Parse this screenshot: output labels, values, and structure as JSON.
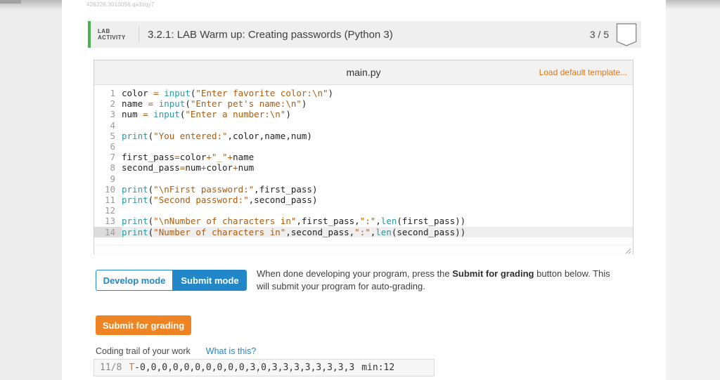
{
  "page": {
    "doc_id": "426226.3010056.qx3zqy7"
  },
  "colors": {
    "blue": "#2187c9",
    "orange": "#ee8424",
    "orange_link": "#e87511",
    "green": "#4caf50",
    "syn_plain": "#222222",
    "syn_builtin": "#2b9aa0",
    "syn_string": "#ad5b0e",
    "syn_op": "#a9590c"
  },
  "header": {
    "kicker_line1": "LAB",
    "kicker_line2": "ACTIVITY",
    "title": "3.2.1: LAB Warm up: Creating passwords (Python 3)",
    "score": "3 / 5"
  },
  "editor": {
    "filename": "main.py",
    "load_template_label": "Load default template...",
    "lines": [
      {
        "no": "1",
        "hl": false,
        "tokens": [
          [
            "p",
            "color "
          ],
          [
            "o",
            "="
          ],
          [
            "p",
            " "
          ],
          [
            "b",
            "input"
          ],
          [
            "p",
            "("
          ],
          [
            "s",
            "\"Enter favorite color:\\n\""
          ],
          [
            "p",
            ")"
          ]
        ]
      },
      {
        "no": "2",
        "hl": false,
        "tokens": [
          [
            "p",
            "name "
          ],
          [
            "o",
            "="
          ],
          [
            "p",
            " "
          ],
          [
            "b",
            "input"
          ],
          [
            "p",
            "("
          ],
          [
            "s",
            "\"Enter pet's name:\\n\""
          ],
          [
            "p",
            ")"
          ]
        ]
      },
      {
        "no": "3",
        "hl": false,
        "tokens": [
          [
            "p",
            "num "
          ],
          [
            "o",
            "="
          ],
          [
            "p",
            " "
          ],
          [
            "b",
            "input"
          ],
          [
            "p",
            "("
          ],
          [
            "s",
            "\"Enter a number:\\n\""
          ],
          [
            "p",
            ")"
          ]
        ]
      },
      {
        "no": "4",
        "hl": false,
        "tokens": []
      },
      {
        "no": "5",
        "hl": false,
        "tokens": [
          [
            "b",
            "print"
          ],
          [
            "p",
            "("
          ],
          [
            "s",
            "\"You entered:\""
          ],
          [
            "p",
            ",color,name,num)"
          ]
        ]
      },
      {
        "no": "6",
        "hl": false,
        "tokens": []
      },
      {
        "no": "7",
        "hl": false,
        "tokens": [
          [
            "p",
            "first_pass"
          ],
          [
            "o",
            "="
          ],
          [
            "p",
            "color"
          ],
          [
            "o",
            "+"
          ],
          [
            "s",
            "\"_\""
          ],
          [
            "o",
            "+"
          ],
          [
            "p",
            "name"
          ]
        ]
      },
      {
        "no": "8",
        "hl": false,
        "tokens": [
          [
            "p",
            "second_pass"
          ],
          [
            "o",
            "="
          ],
          [
            "p",
            "num"
          ],
          [
            "o",
            "+"
          ],
          [
            "p",
            "color"
          ],
          [
            "o",
            "+"
          ],
          [
            "p",
            "num"
          ]
        ]
      },
      {
        "no": "9",
        "hl": false,
        "tokens": []
      },
      {
        "no": "10",
        "hl": false,
        "tokens": [
          [
            "b",
            "print"
          ],
          [
            "p",
            "("
          ],
          [
            "s",
            "\"\\nFirst password:\""
          ],
          [
            "p",
            ",first_pass)"
          ]
        ]
      },
      {
        "no": "11",
        "hl": false,
        "tokens": [
          [
            "b",
            "print"
          ],
          [
            "p",
            "("
          ],
          [
            "s",
            "\"Second password:\""
          ],
          [
            "p",
            ",second_pass)"
          ]
        ]
      },
      {
        "no": "12",
        "hl": false,
        "tokens": []
      },
      {
        "no": "13",
        "hl": false,
        "tokens": [
          [
            "b",
            "print"
          ],
          [
            "p",
            "("
          ],
          [
            "s",
            "\"\\nNumber of characters in\""
          ],
          [
            "p",
            ",first_pass,"
          ],
          [
            "s",
            "\":\""
          ],
          [
            "p",
            ","
          ],
          [
            "b",
            "len"
          ],
          [
            "p",
            "(first_pass))"
          ]
        ]
      },
      {
        "no": "14",
        "hl": true,
        "tokens": [
          [
            "b",
            "print"
          ],
          [
            "p",
            "("
          ],
          [
            "s",
            "\"Number of characters in\""
          ],
          [
            "p",
            ",second_pass,"
          ],
          [
            "s",
            "\":\""
          ],
          [
            "p",
            ","
          ],
          [
            "b",
            "len"
          ],
          [
            "p",
            "(second_pass))"
          ]
        ]
      }
    ]
  },
  "modes": {
    "develop_label": "Develop mode",
    "submit_label": "Submit mode"
  },
  "instructions": {
    "before_bold": "When done developing your program, press the ",
    "bold": "Submit for grading",
    "after_bold": " button below. This will submit your program for auto-grading."
  },
  "submit": {
    "label": "Submit for grading"
  },
  "coding_trail": {
    "label": "Coding trail of your work",
    "help_link": "What is this?",
    "ratio": "11/8",
    "t_prefix": "T",
    "values": "-0,0,0,0,0,0,0,0,0,0,3,0,3,3,3,3,3,3,3,3",
    "min": "min:12"
  }
}
